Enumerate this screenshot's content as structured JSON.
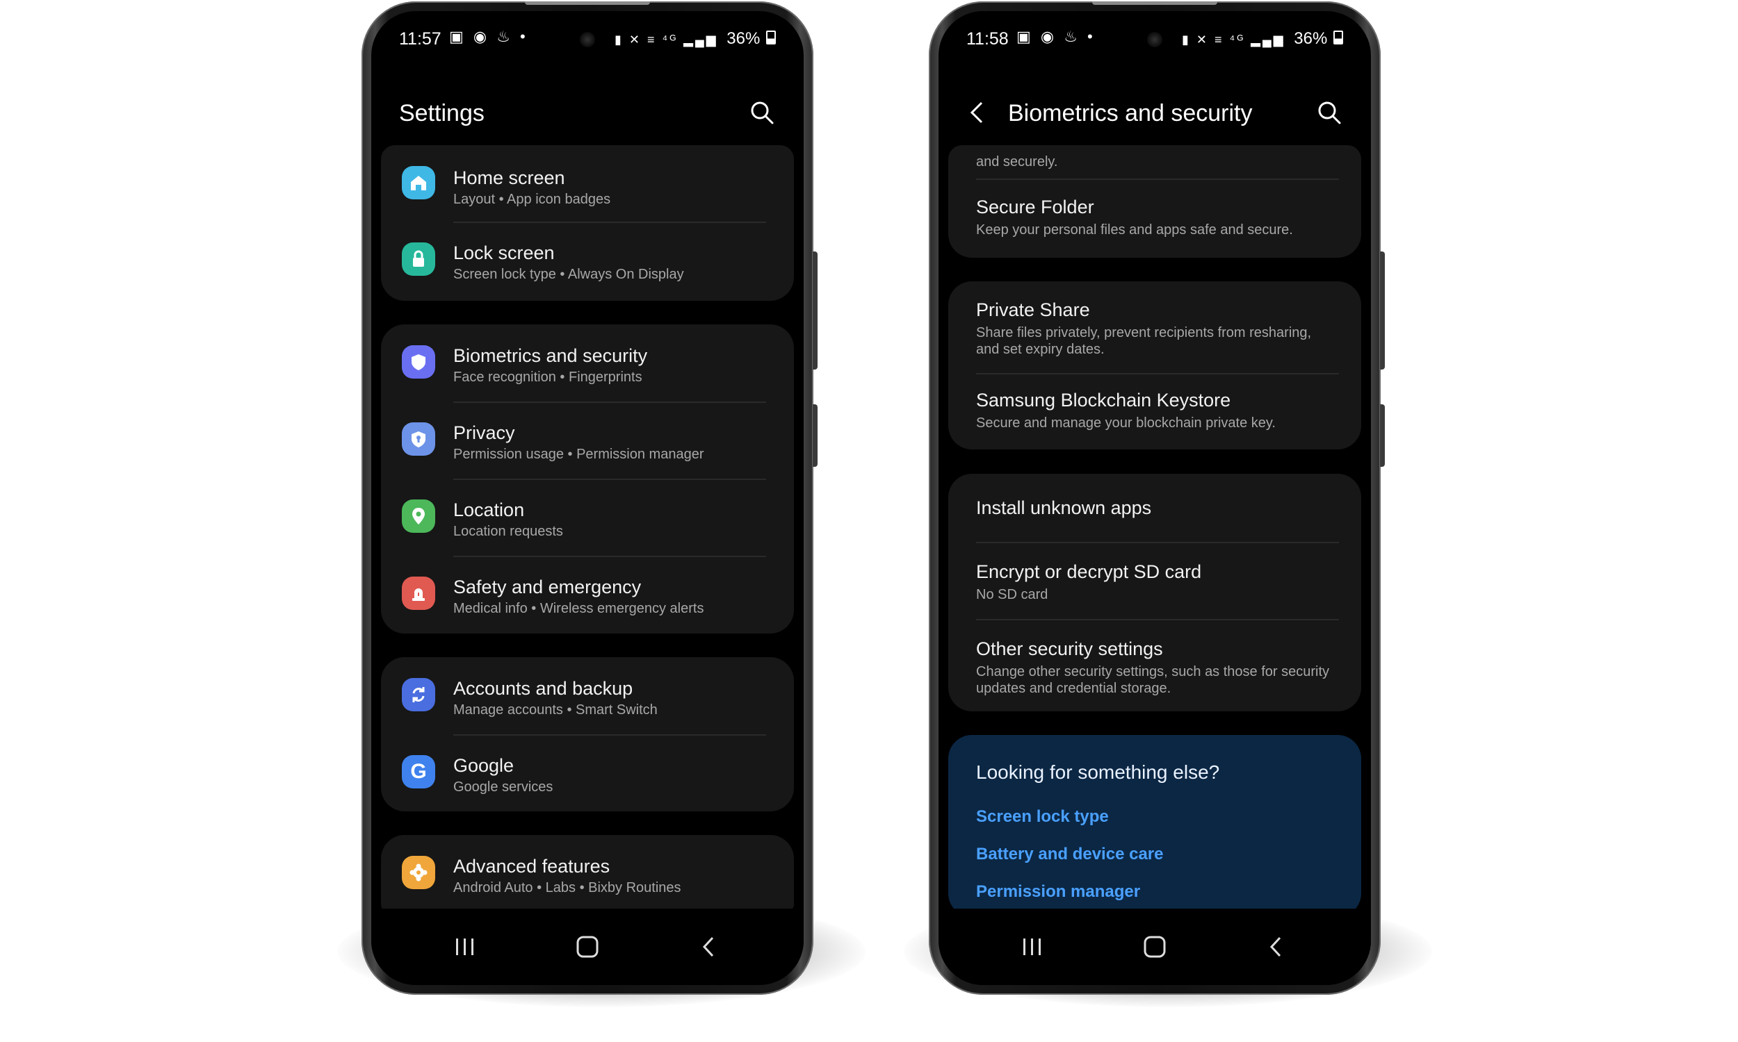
{
  "phone1": {
    "status": {
      "time": "11:57",
      "battery": "36%"
    },
    "title": "Settings",
    "groups": [
      [
        {
          "label": "Home screen",
          "sub": "Layout  •  App icon badges",
          "color": "#3fb8e6",
          "icon": "home-icon"
        },
        {
          "label": "Lock screen",
          "sub": "Screen lock type  •  Always On Display",
          "color": "#27b89b",
          "icon": "lock-icon"
        }
      ],
      [
        {
          "label": "Biometrics and security",
          "sub": "Face recognition  •  Fingerprints",
          "color": "#6a6ff2",
          "icon": "shield-icon"
        },
        {
          "label": "Privacy",
          "sub": "Permission usage  •  Permission manager",
          "color": "#6d93e8",
          "icon": "privacy-shield-icon"
        },
        {
          "label": "Location",
          "sub": "Location requests",
          "color": "#4cb85a",
          "icon": "location-pin-icon"
        },
        {
          "label": "Safety and emergency",
          "sub": "Medical info  •  Wireless emergency alerts",
          "color": "#e05a52",
          "icon": "siren-icon"
        }
      ],
      [
        {
          "label": "Accounts and backup",
          "sub": "Manage accounts  •  Smart Switch",
          "color": "#4a6ee0",
          "icon": "sync-icon"
        },
        {
          "label": "Google",
          "sub": "Google services",
          "color": "#3f82ee",
          "icon": "google-g-icon"
        }
      ],
      [
        {
          "label": "Advanced features",
          "sub": "Android Auto  •  Labs  •  Bixby Routines",
          "color": "#f0a63a",
          "icon": "gear-plus-icon"
        }
      ]
    ]
  },
  "phone2": {
    "status": {
      "time": "11:58",
      "battery": "36%"
    },
    "title": "Biometrics and security",
    "partial_text": "and securely.",
    "groups": [
      [
        {
          "label": "Secure Folder",
          "sub": "Keep your personal files and apps safe and secure."
        }
      ],
      [
        {
          "label": "Private Share",
          "sub": "Share files privately, prevent recipients from resharing, and set expiry dates."
        },
        {
          "label": "Samsung Blockchain Keystore",
          "sub": "Secure and manage your blockchain private key."
        }
      ],
      [
        {
          "label": "Install unknown apps",
          "sub": ""
        },
        {
          "label": "Encrypt or decrypt SD card",
          "sub": "No SD card"
        },
        {
          "label": "Other security settings",
          "sub": "Change other security settings, such as those for security updates and credential storage."
        }
      ]
    ],
    "looking": {
      "title": "Looking for something else?",
      "links": [
        "Screen lock type",
        "Battery and device care",
        "Permission manager"
      ]
    }
  }
}
